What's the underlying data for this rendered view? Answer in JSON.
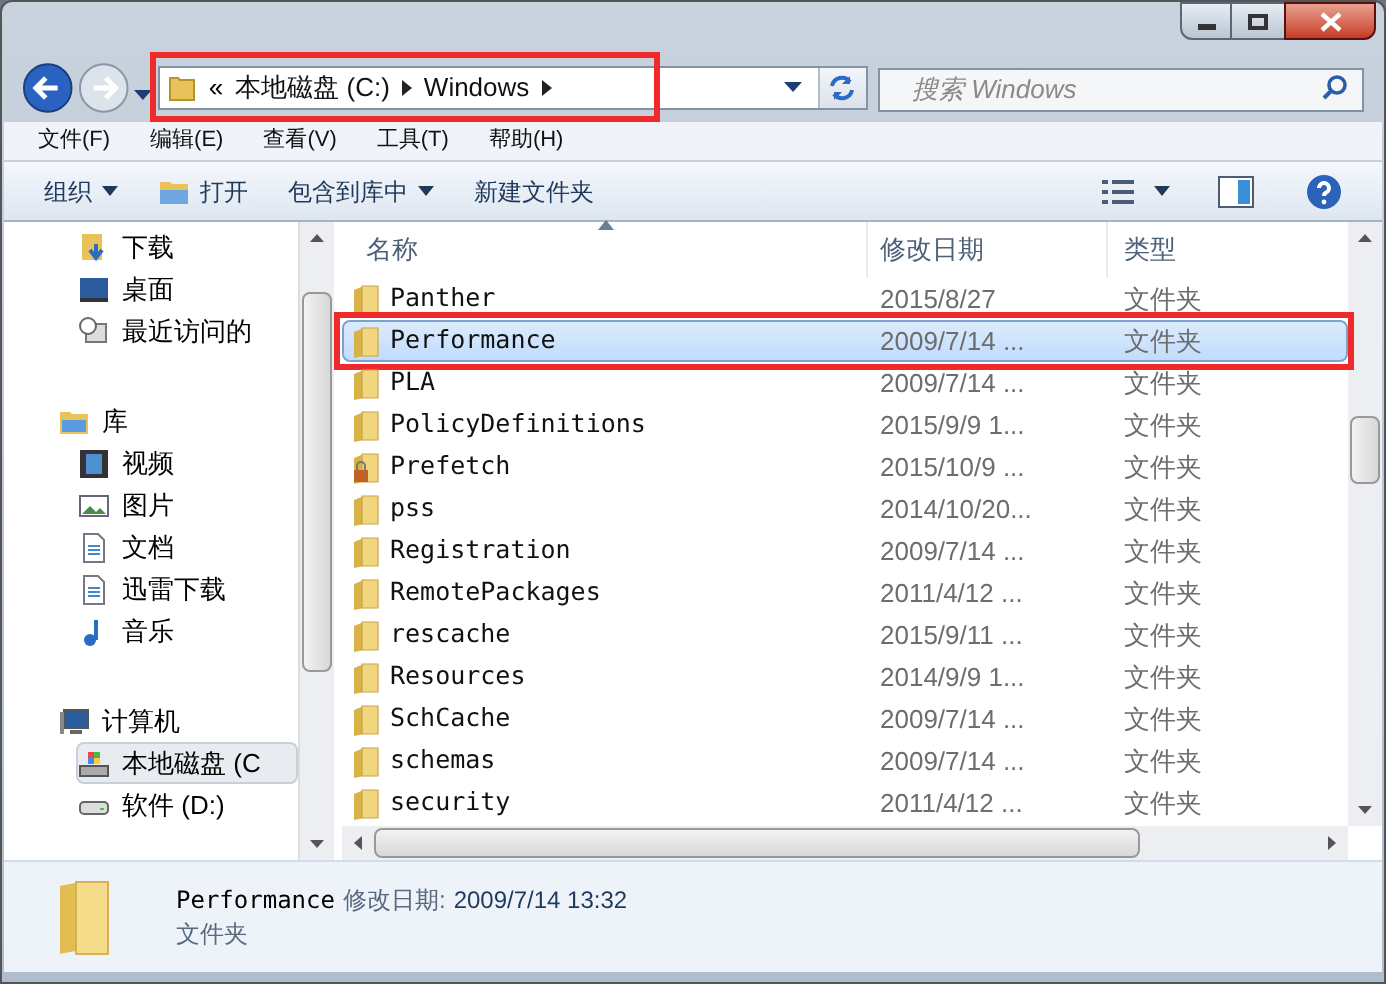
{
  "address_bar": {
    "overflow": "«",
    "crumbs": [
      "本地磁盘 (C:)",
      "Windows"
    ],
    "annotated": true
  },
  "search": {
    "placeholder": "搜索 Windows"
  },
  "menu": [
    "文件(F)",
    "编辑(E)",
    "查看(V)",
    "工具(T)",
    "帮助(H)"
  ],
  "toolbar": [
    {
      "label": "组织",
      "kind": "dropdown"
    },
    {
      "label": "打开",
      "kind": "icon"
    },
    {
      "label": "包含到库中",
      "kind": "dropdown"
    },
    {
      "label": "新建文件夹",
      "kind": "plain"
    }
  ],
  "sidebar": [
    {
      "label": "下载",
      "selected": false
    },
    {
      "label": "桌面",
      "selected": false
    },
    {
      "label": "最近访问的",
      "selected": false
    },
    {
      "label": "库",
      "selected": false,
      "children": [
        {
          "label": "视频",
          "selected": false
        },
        {
          "label": "图片",
          "selected": false
        },
        {
          "label": "文档",
          "selected": false
        },
        {
          "label": "迅雷下载",
          "selected": false
        },
        {
          "label": "音乐",
          "selected": false
        }
      ]
    },
    {
      "label": "计算机",
      "selected": false,
      "children": [
        {
          "label": "本地磁盘 (C",
          "selected": true
        },
        {
          "label": "软件 (D:)",
          "selected": false
        }
      ]
    }
  ],
  "file_list": {
    "columns": [
      "名称",
      "修改日期",
      "类型"
    ],
    "rows": [
      {
        "name": "Panther",
        "date": "2015/8/27",
        "type": "文件夹",
        "selected": false,
        "locked": false,
        "annotated": false
      },
      {
        "name": "Performance",
        "date": "2009/7/14 ...",
        "type": "文件夹",
        "selected": true,
        "locked": false,
        "annotated": true
      },
      {
        "name": "PLA",
        "date": "2009/7/14 ...",
        "type": "文件夹",
        "selected": false,
        "locked": false,
        "annotated": false
      },
      {
        "name": "PolicyDefinitions",
        "date": "2015/9/9 1...",
        "type": "文件夹",
        "selected": false,
        "locked": false,
        "annotated": false
      },
      {
        "name": "Prefetch",
        "date": "2015/10/9 ...",
        "type": "文件夹",
        "selected": false,
        "locked": true,
        "annotated": false
      },
      {
        "name": "pss",
        "date": "2014/10/20...",
        "type": "文件夹",
        "selected": false,
        "locked": false,
        "annotated": false
      },
      {
        "name": "Registration",
        "date": "2009/7/14 ...",
        "type": "文件夹",
        "selected": false,
        "locked": false,
        "annotated": false
      },
      {
        "name": "RemotePackages",
        "date": "2011/4/12 ...",
        "type": "文件夹",
        "selected": false,
        "locked": false,
        "annotated": false
      },
      {
        "name": "rescache",
        "date": "2015/9/11 ...",
        "type": "文件夹",
        "selected": false,
        "locked": false,
        "annotated": false
      },
      {
        "name": "Resources",
        "date": "2014/9/9 1...",
        "type": "文件夹",
        "selected": false,
        "locked": false,
        "annotated": false
      },
      {
        "name": "SchCache",
        "date": "2009/7/14 ...",
        "type": "文件夹",
        "selected": false,
        "locked": false,
        "annotated": false
      },
      {
        "name": "schemas",
        "date": "2009/7/14 ...",
        "type": "文件夹",
        "selected": false,
        "locked": false,
        "annotated": false
      },
      {
        "name": "security",
        "date": "2011/4/12 ...",
        "type": "文件夹",
        "selected": false,
        "locked": false,
        "annotated": false
      }
    ]
  },
  "details": {
    "name": "Performance",
    "date_label": "修改日期:",
    "date": "2009/7/14 13:32",
    "type": "文件夹"
  }
}
